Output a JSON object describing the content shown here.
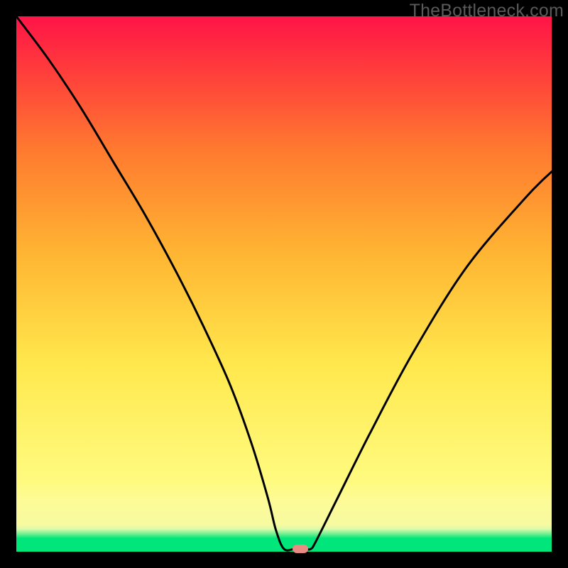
{
  "brand": {
    "text": "TheBottleneck.com"
  },
  "chart_data": {
    "type": "line",
    "title": "",
    "xlabel": "",
    "ylabel": "",
    "xlim": [
      0,
      100
    ],
    "ylim": [
      0,
      100
    ],
    "series": [
      {
        "name": "bottleneck-curve",
        "x": [
          0,
          6,
          12,
          18,
          24,
          30,
          35,
          40,
          44,
          47,
          48.5,
          50,
          52,
          54,
          55,
          56,
          60,
          66,
          74,
          84,
          95,
          100
        ],
        "values": [
          100,
          92,
          83,
          73,
          63,
          52,
          42,
          31,
          20,
          10,
          4,
          0.5,
          0.5,
          0.5,
          0.5,
          2,
          10,
          22,
          37,
          53,
          66,
          71
        ]
      }
    ],
    "marker": {
      "x": 53,
      "y": 0.5,
      "color": "#e98b82"
    },
    "gradient_colors": {
      "top": "#ff1447",
      "upper_mid": "#ff7a2f",
      "mid": "#ffe84d",
      "lower_mid": "#fffb80",
      "bottom": "#00e67a"
    }
  }
}
